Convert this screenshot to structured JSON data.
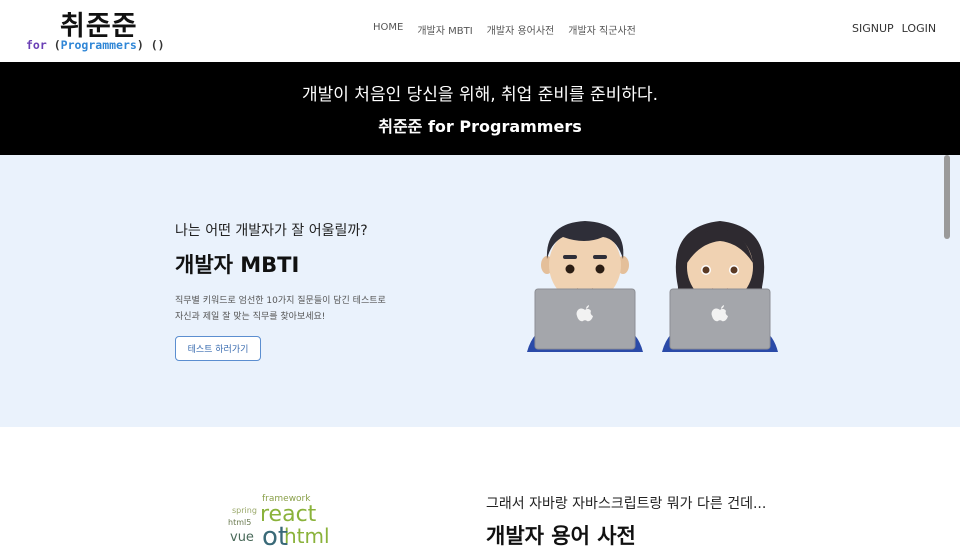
{
  "header": {
    "logo_main": "취준준",
    "logo_sub_for": "for",
    "logo_sub_open": "(",
    "logo_sub_word": "Programmers",
    "logo_sub_close": ")",
    "logo_sub_end": "()",
    "nav": [
      "HOME",
      "개발자 MBTI",
      "개발자 용어사전",
      "개발자 직군사전"
    ],
    "signup": "SIGNUP",
    "login": "LOGIN"
  },
  "banner": {
    "line1": "개발이 처음인 당신을 위해, 취업 준비를 준비하다.",
    "line2": "취준준 for Programmers"
  },
  "mbti": {
    "subtitle": "나는 어떤 개발자가 잘 어울릴까?",
    "title": "개발자 MBTI",
    "desc_line1": "직무별 키워드로 엄선한 10가지 질문들이 담긴 테스트로",
    "desc_line2": "자신과 제일 잘 맞는 직무를 찾아보세요!",
    "button": "테스트 하러가기"
  },
  "glossary": {
    "subtitle": "그래서 자바랑 자바스크립트랑 뭐가 다른 건데...",
    "title": "개발자 용어 사전",
    "cloud": {
      "w1": "framework",
      "w2": "spring",
      "w3": "react",
      "w4": "html5",
      "w5": "vue",
      "w6": "html",
      "w7": "ot"
    }
  },
  "colors": {
    "banner_bg": "#000000",
    "section_bg": "#eaf2fc",
    "logo_purple": "#6a3fb5",
    "logo_blue": "#2f86d6",
    "button_border": "#5b8ed0"
  }
}
